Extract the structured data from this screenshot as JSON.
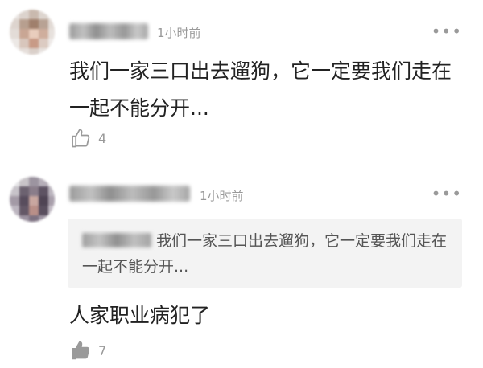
{
  "comments": [
    {
      "username": "",
      "time": "1小时前",
      "more_icon": "more-dots-icon",
      "content": "我们一家三口出去遛狗，它一定要我们走在一起不能分开...",
      "likes": "4",
      "liked": false,
      "like_icon": "thumbs-up-outline-icon"
    },
    {
      "username": "",
      "time": "1小时前",
      "more_icon": "more-dots-icon",
      "quote": {
        "username": "",
        "text": "我们一家三口出去遛狗，它一定要我们走在一起不能分开..."
      },
      "content": "人家职业病犯了",
      "likes": "7",
      "liked": true,
      "like_icon": "thumbs-up-filled-icon"
    }
  ],
  "colors": {
    "text": "#222222",
    "meta": "#999999",
    "quote_bg": "#f3f3f3",
    "divider": "#ececec"
  }
}
